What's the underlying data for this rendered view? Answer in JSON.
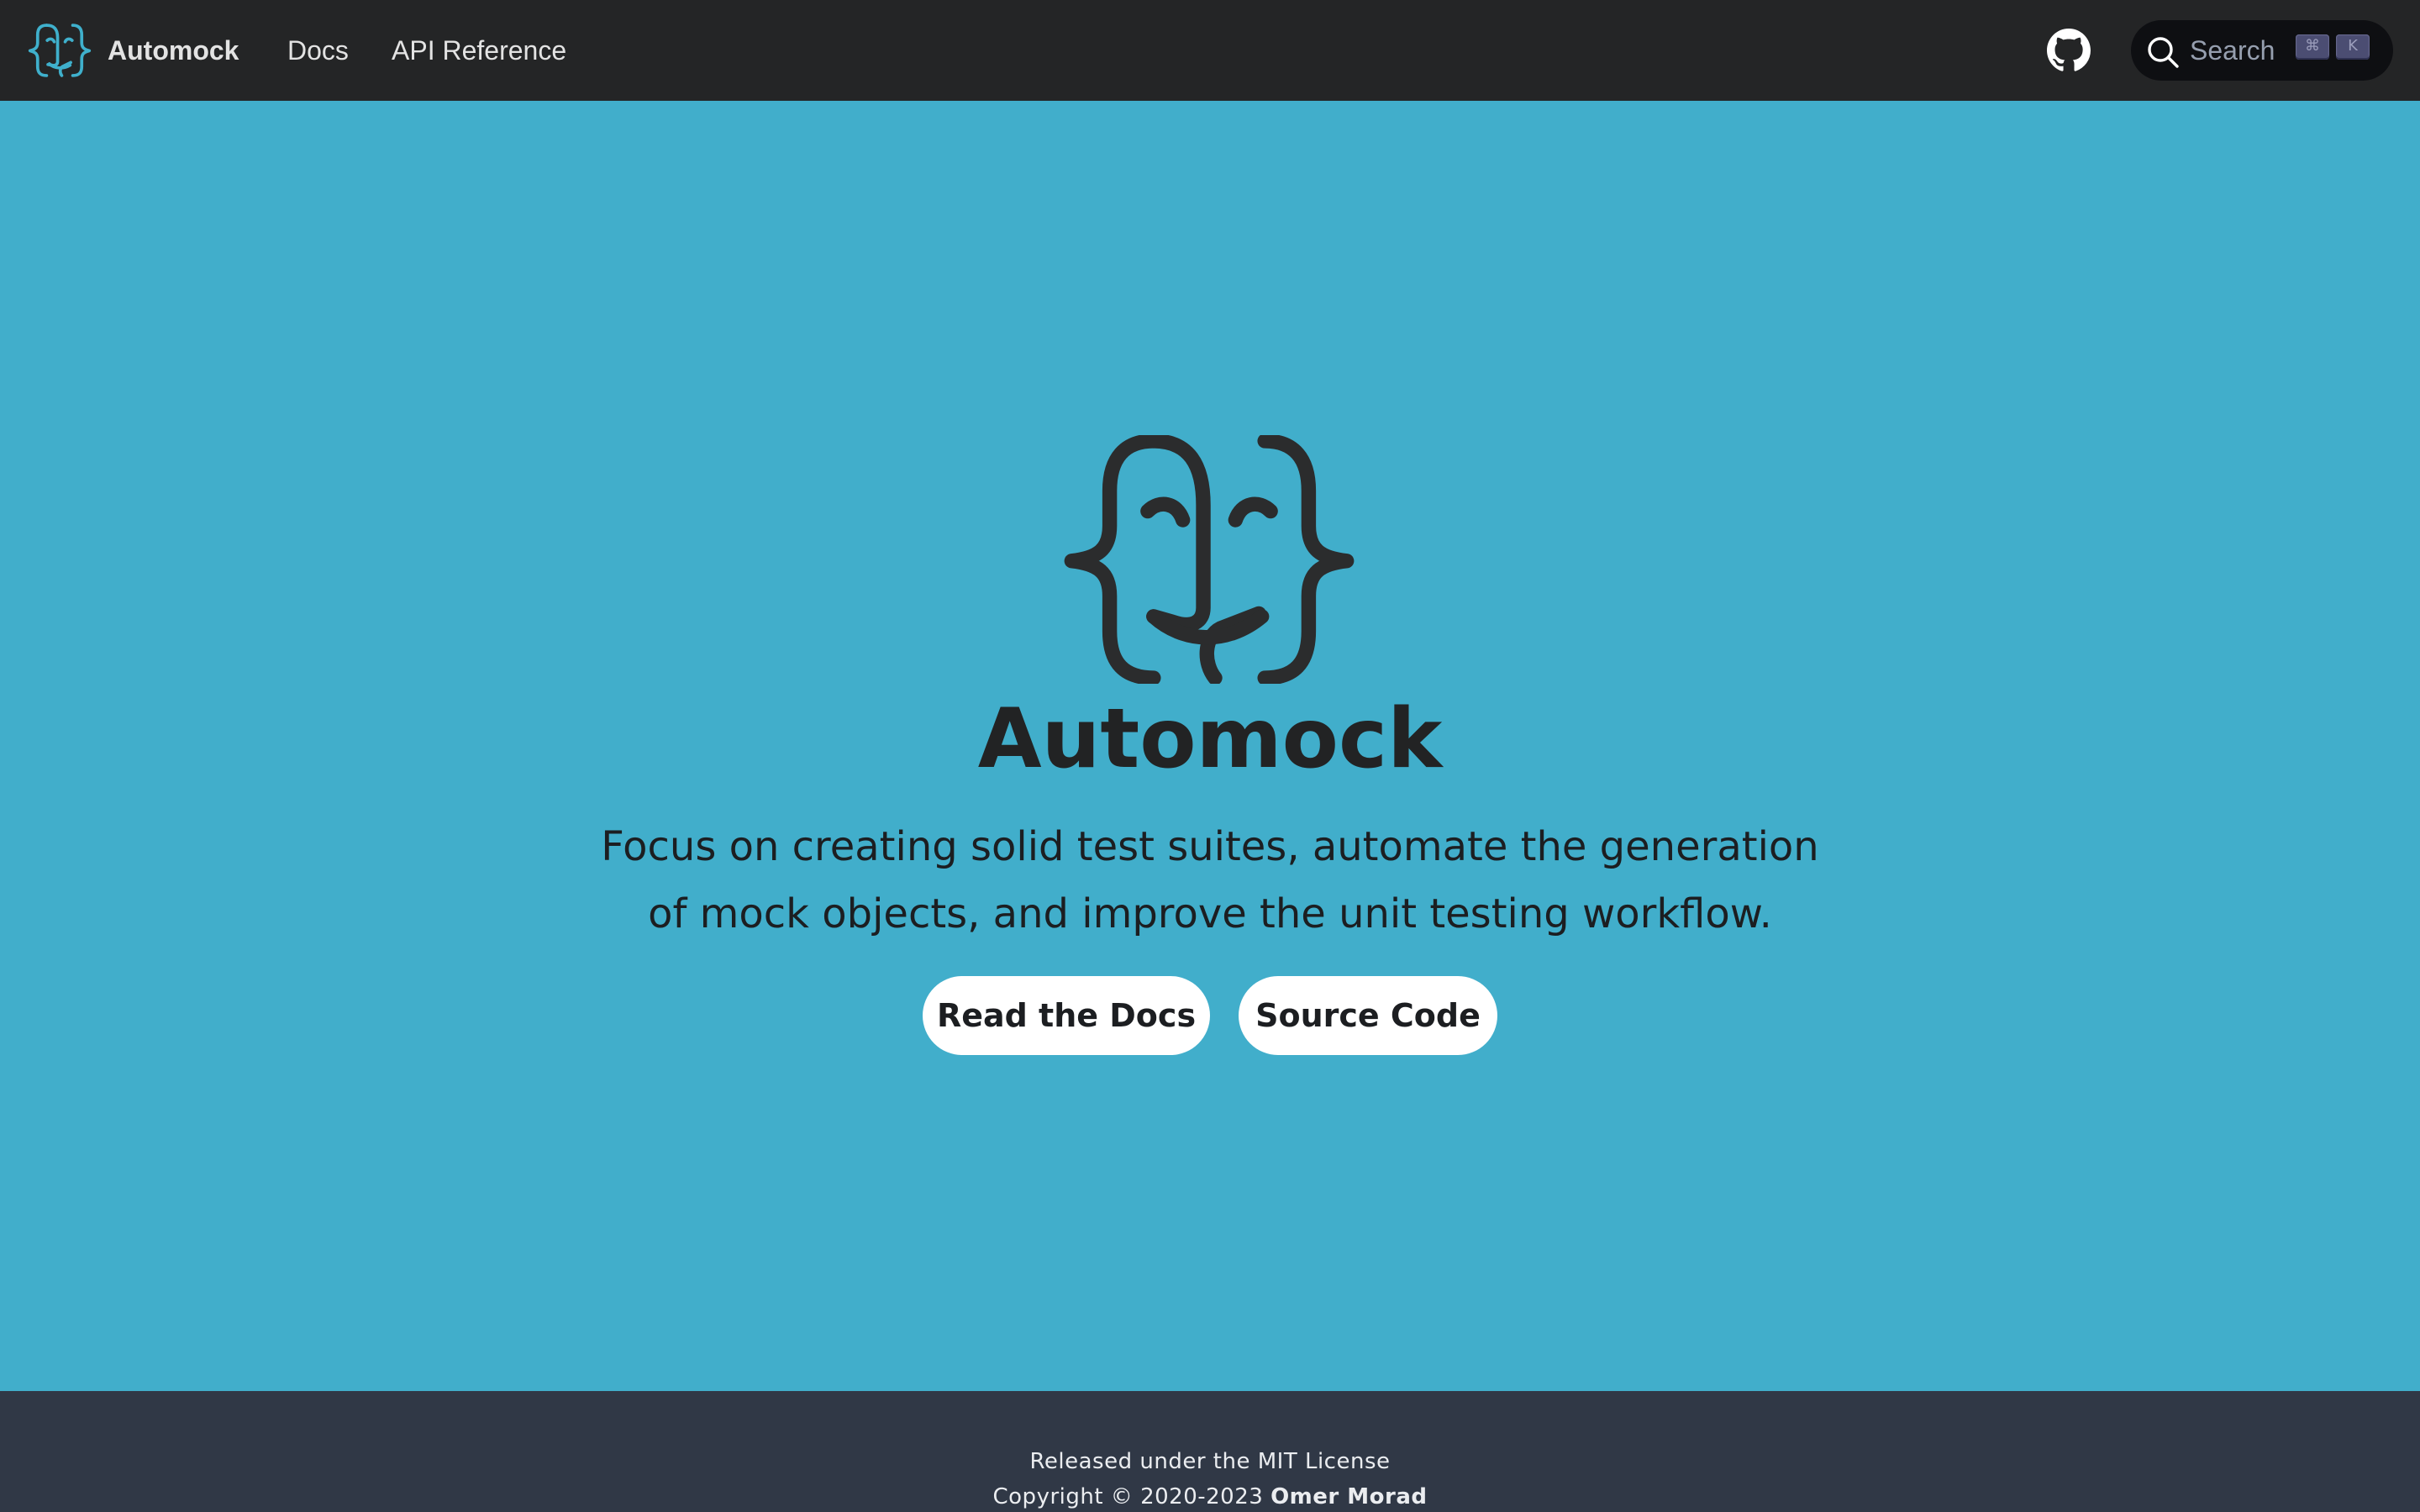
{
  "navbar": {
    "brand_title": "Automock",
    "links": [
      {
        "label": "Docs"
      },
      {
        "label": "API Reference"
      }
    ],
    "github_icon": "github-icon",
    "search": {
      "placeholder": "Search",
      "shortcut_keys": [
        "⌘",
        "K"
      ]
    }
  },
  "hero": {
    "title": "Automock",
    "subtitle": "Focus on creating solid test suites, automate the generation of mock objects, and improve the unit testing workflow.",
    "buttons": [
      {
        "label": "Read the Docs"
      },
      {
        "label": "Source Code"
      }
    ]
  },
  "footer": {
    "license": "Released under the MIT License",
    "copyright_prefix": "Copyright © 2020-2023",
    "copyright_author": "Omer Morad"
  },
  "colors": {
    "navbar_bg": "#242526",
    "hero_bg": "#41aecb",
    "footer_bg": "#303846",
    "logo_accent": "#3fb0cc",
    "logo_dark": "#2b2c2d",
    "button_bg": "#ffffff"
  }
}
